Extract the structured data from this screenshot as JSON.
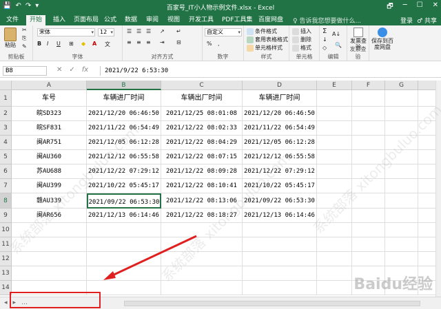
{
  "window": {
    "title": "百家号_IT小人物示例文件.xlsx - Excel",
    "qat": [
      "💾",
      "↶",
      "↷",
      "▾"
    ],
    "controls": [
      "🗗",
      "─",
      "☐",
      "✕"
    ]
  },
  "tabs": [
    "文件",
    "开始",
    "插入",
    "页面布局",
    "公式",
    "数据",
    "审阅",
    "视图",
    "开发工具",
    "PDF工具集",
    "百度网盘"
  ],
  "active_tab": "开始",
  "tell_me": "♀ 告诉我您想要做什么...",
  "account": {
    "login": "登录",
    "share": "♂ 共享"
  },
  "ribbon": {
    "clipboard": {
      "label": "剪贴板",
      "paste": "粘贴",
      "cut": "✂",
      "copy": "⎘",
      "painter": "✎"
    },
    "font": {
      "label": "字体",
      "name": "宋体",
      "size": "12",
      "grow": "A",
      "shrink": "A",
      "bold": "B",
      "italic": "I",
      "underline": "U",
      "border": "⊞",
      "fill": "◆",
      "color": "A",
      "phonetic": "文"
    },
    "alignment": {
      "label": "对齐方式"
    },
    "number": {
      "label": "数字",
      "format": "自定义",
      "currency": "%",
      "comma": ","
    },
    "styles": {
      "label": "样式",
      "conditional": "条件格式",
      "table": "套用表格格式",
      "cell": "单元格样式"
    },
    "cells": {
      "label": "单元格",
      "insert": "插入",
      "delete": "删除",
      "format": "格式"
    },
    "editing": {
      "label": "编辑",
      "sum": "Σ",
      "fill": "↓",
      "clear": "◇",
      "sort": "A↓",
      "find": "🔍"
    },
    "invoice": {
      "label": "发票查验",
      "check": "发票查验"
    },
    "save": {
      "label": "保存到百度网盘",
      "btn": "保存到百度网盘"
    }
  },
  "formula_bar": {
    "name_box": "B8",
    "fx": "fx",
    "cancel": "✕",
    "confirm": "✓",
    "value": "2021/9/22  6:53:30"
  },
  "columns": [
    "A",
    "B",
    "C",
    "D",
    "E",
    "F",
    "G"
  ],
  "selected_column": "B",
  "selected_row": "8",
  "rows": [
    "1",
    "2",
    "3",
    "4",
    "5",
    "6",
    "7",
    "8",
    "9",
    "10",
    "11",
    "12",
    "13",
    "14"
  ],
  "table": {
    "headers": [
      "车号",
      "车辆进厂时间",
      "车辆出厂时间",
      "车辆进厂时间"
    ],
    "data": [
      [
        "皖SD323",
        "2021/12/20 06:46:50",
        "2021/12/25 08:01:08",
        "2021/12/20 06:46:50"
      ],
      [
        "皖SF831",
        "2021/11/22 06:54:49",
        "2021/12/22 08:02:33",
        "2021/11/22 06:54:49"
      ],
      [
        "闽AR751",
        "2021/12/05 06:12:28",
        "2021/12/22 08:04:29",
        "2021/12/05 06:12:28"
      ],
      [
        "闽AU360",
        "2021/12/12 06:55:58",
        "2021/12/22 08:07:15",
        "2021/12/12 06:55:58"
      ],
      [
        "苏AU688",
        "2021/12/22 07:29:12",
        "2021/12/22 08:09:28",
        "2021/12/22 07:29:12"
      ],
      [
        "闽AU399",
        "2021/10/22 05:45:17",
        "2021/12/22 08:10:41",
        "2021/10/22 05:45:17"
      ],
      [
        "赣AU339",
        "2021/09/22 06:53:30",
        "2021/12/22 08:13:06",
        "2021/09/22 06:53:30"
      ],
      [
        "闽AR656",
        "2021/12/13 06:14:46",
        "2021/12/22 08:18:27",
        "2021/12/13 06:14:46"
      ]
    ]
  },
  "sheet_nav": [
    "◂",
    "▸",
    "…"
  ],
  "watermark": "系统部落 xitongbuluo.com",
  "baidu": "Baidu经验",
  "colors": {
    "accent": "#217346",
    "annotation": "#e02020"
  }
}
